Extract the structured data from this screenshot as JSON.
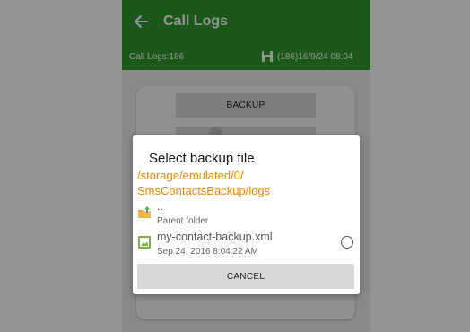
{
  "appbar": {
    "title": "Call Logs",
    "back_icon": "back-arrow-icon",
    "color": "#2e9a2e"
  },
  "status": {
    "count_text": "Call Logs:186",
    "save_icon": "save-icon",
    "last_backup": "(186)16/9/24 08:04"
  },
  "main": {
    "backup_label": "BACKUP"
  },
  "dialog": {
    "title": "Select backup file",
    "path_line1": "/storage/emulated/0/",
    "path_line2": "SmsContactsBackup/logs",
    "parent": {
      "name": "..",
      "label": "Parent folder",
      "icon": "folder-up-icon"
    },
    "file": {
      "name": "my-contact-backup.xml",
      "date": "Sep 24, 2016 8:04:22 AM",
      "icon": "file-icon",
      "selected": false
    },
    "cancel_label": "CANCEL",
    "accent_color": "#f08a00"
  }
}
